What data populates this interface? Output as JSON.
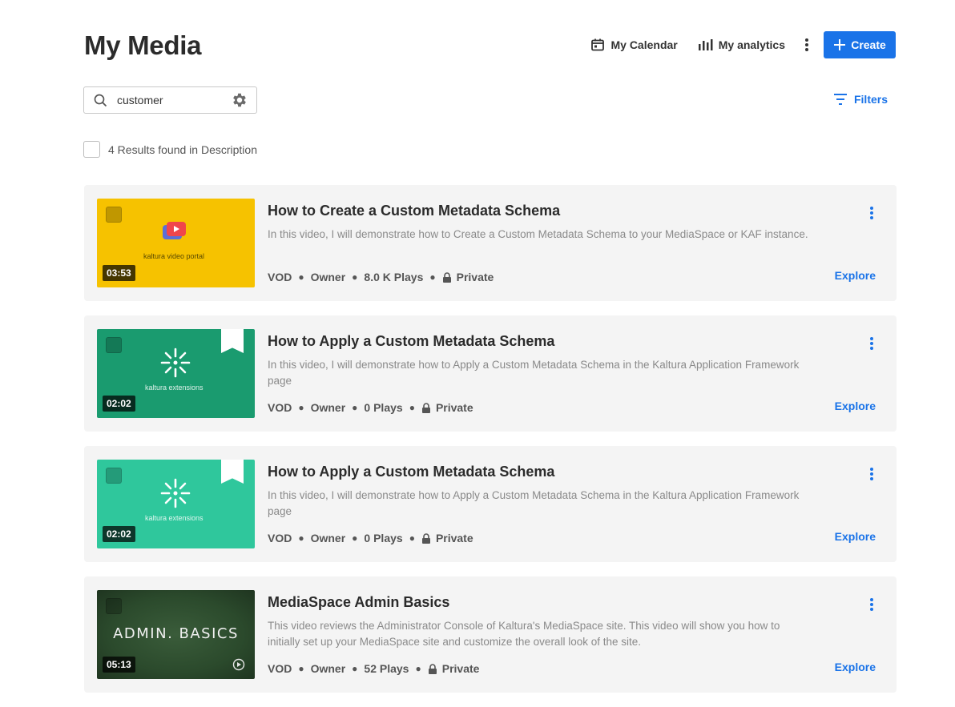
{
  "header": {
    "title": "My Media",
    "calendar_label": "My Calendar",
    "analytics_label": "My analytics",
    "create_label": "Create"
  },
  "search": {
    "value": "customer"
  },
  "filters_label": "Filters",
  "results_text": "4 Results found in Description",
  "colors": {
    "accent": "#1a73e8",
    "card_bg": "#f4f4f4"
  },
  "items": [
    {
      "title": "How to Create a Custom Metadata Schema",
      "description": "In this video, I will demonstrate how to Create a Custom Metadata Schema to your MediaSpace or KAF instance.",
      "type": "VOD",
      "role": "Owner",
      "plays": "8.0 K Plays",
      "privacy": "Private",
      "duration": "03:53",
      "thumb_brand": "kaltura video portal",
      "explore_label": "Explore"
    },
    {
      "title": "How to Apply a Custom Metadata Schema",
      "description": "In this video, I will demonstrate how to Apply a Custom Metadata Schema in the Kaltura Application Framework page",
      "type": "VOD",
      "role": "Owner",
      "plays": "0 Plays",
      "privacy": "Private",
      "duration": "02:02",
      "thumb_brand": "kaltura extensions",
      "explore_label": "Explore"
    },
    {
      "title": "How to Apply a Custom Metadata Schema",
      "description": "In this video, I will demonstrate how to Apply a Custom Metadata Schema in the Kaltura Application Framework page",
      "type": "VOD",
      "role": "Owner",
      "plays": "0 Plays",
      "privacy": "Private",
      "duration": "02:02",
      "thumb_brand": "kaltura extensions",
      "explore_label": "Explore"
    },
    {
      "title": "MediaSpace Admin Basics",
      "description": "This video reviews the Administrator Console of Kaltura's MediaSpace site. This video will show you how to initially set up your MediaSpace site and customize the overall look of the site.",
      "type": "VOD",
      "role": "Owner",
      "plays": "52 Plays",
      "privacy": "Private",
      "duration": "05:13",
      "thumb_text": "ADMIN. BASICS",
      "explore_label": "Explore"
    }
  ]
}
